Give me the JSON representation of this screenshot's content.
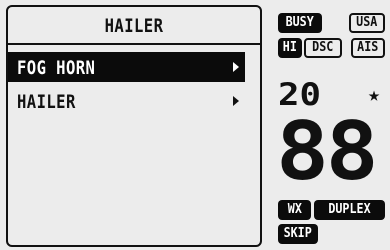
{
  "menu": {
    "title": "HAILER",
    "items": [
      {
        "label": "FOG HORN",
        "selected": true,
        "icon": "chevron-right-icon"
      },
      {
        "label": "HAILER",
        "selected": false,
        "icon": "chevron-right-icon"
      }
    ]
  },
  "status": {
    "badges_row1": [
      {
        "label": "BUSY",
        "style": "filled"
      },
      {
        "label": "USA",
        "style": "outline"
      }
    ],
    "badges_row2": [
      {
        "label": "HI",
        "style": "filled"
      },
      {
        "label": "DSC",
        "style": "outline"
      },
      {
        "label": "AIS",
        "style": "outline"
      }
    ],
    "channel_small": "20",
    "favorite_icon": "star-icon",
    "channel_big": "88",
    "badges_row3": [
      {
        "label": "WX",
        "style": "filled"
      },
      {
        "label": "DUPLEX",
        "style": "filled"
      }
    ],
    "badges_row4": [
      {
        "label": "SKIP",
        "style": "filled"
      }
    ]
  },
  "colors": {
    "background": "#ececec",
    "foreground": "#111111",
    "highlight": "#0b0b0b"
  }
}
